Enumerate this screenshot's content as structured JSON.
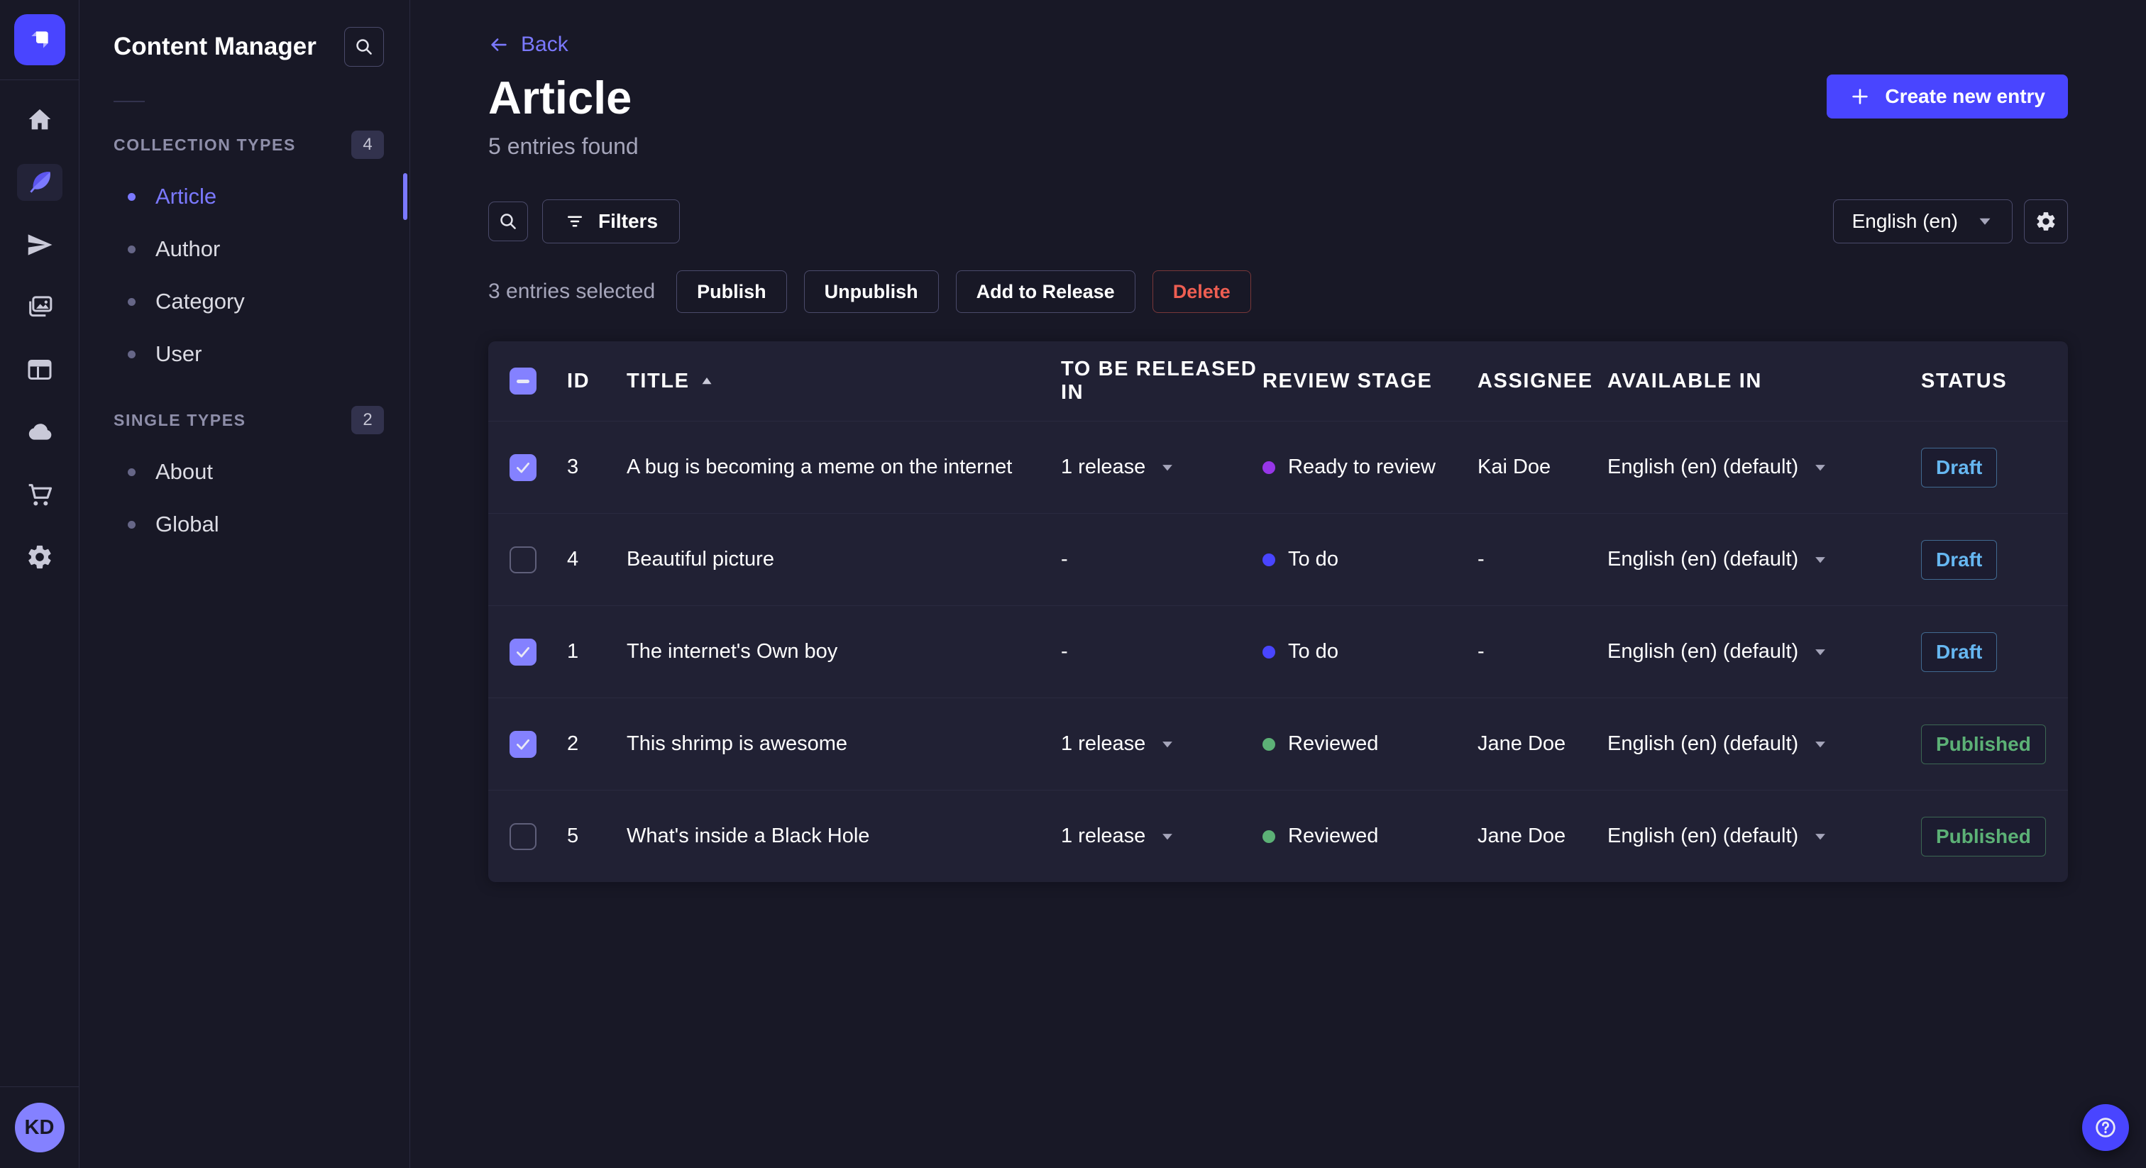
{
  "colors": {
    "pageBg": "#181826",
    "panelBg": "#212134",
    "border": "#2a2a3f",
    "controlBorder": "#4a4a6a",
    "accent": "#4945ff",
    "accentLight": "#7b79ff",
    "textSecondary": "#a5a5ba",
    "danger": "#ee5e52",
    "success": "#5cb176",
    "draftBlue": "#66b7f1"
  },
  "rail": {
    "items": [
      {
        "name": "home",
        "icon": "home",
        "active": false
      },
      {
        "name": "content-manager",
        "icon": "feather",
        "active": true
      },
      {
        "name": "releases",
        "icon": "paper-plane",
        "active": false
      },
      {
        "name": "media-library",
        "icon": "images",
        "active": false
      },
      {
        "name": "content-type-builder",
        "icon": "layout",
        "active": false
      },
      {
        "name": "deploy",
        "icon": "cloud",
        "active": false
      },
      {
        "name": "marketplace",
        "icon": "cart",
        "active": false
      },
      {
        "name": "settings",
        "icon": "gear",
        "active": false
      }
    ],
    "avatar_initials": "KD"
  },
  "sidebar": {
    "title": "Content Manager",
    "collection_types": {
      "label": "COLLECTION TYPES",
      "count": "4",
      "items": [
        {
          "label": "Article",
          "active": true
        },
        {
          "label": "Author",
          "active": false
        },
        {
          "label": "Category",
          "active": false
        },
        {
          "label": "User",
          "active": false
        }
      ]
    },
    "single_types": {
      "label": "SINGLE TYPES",
      "count": "2",
      "items": [
        {
          "label": "About",
          "active": false
        },
        {
          "label": "Global",
          "active": false
        }
      ]
    }
  },
  "header": {
    "back_label": "Back",
    "title": "Article",
    "subtitle": "5 entries found",
    "create_button": "Create new entry"
  },
  "toolbar": {
    "filters_label": "Filters",
    "locale_value": "English (en)"
  },
  "selection": {
    "text": "3 entries selected",
    "actions": [
      {
        "label": "Publish",
        "kind": "default"
      },
      {
        "label": "Unpublish",
        "kind": "default"
      },
      {
        "label": "Add to Release",
        "kind": "default"
      },
      {
        "label": "Delete",
        "kind": "danger"
      }
    ]
  },
  "table": {
    "columns": [
      {
        "label": "ID",
        "sorted": false
      },
      {
        "label": "TITLE",
        "sorted": true
      },
      {
        "label": "TO BE RELEASED IN",
        "sorted": false
      },
      {
        "label": "REVIEW STAGE",
        "sorted": false
      },
      {
        "label": "ASSIGNEE",
        "sorted": false
      },
      {
        "label": "AVAILABLE IN",
        "sorted": false
      },
      {
        "label": "STATUS",
        "sorted": false
      }
    ],
    "header_checkbox": "indeterminate",
    "rows": [
      {
        "checked": true,
        "id": "3",
        "title": "A bug is becoming a meme on the internet",
        "release": "1 release",
        "release_caret": true,
        "stage": {
          "label": "Ready to review",
          "color": "#9736e8"
        },
        "assignee": "Kai Doe",
        "locale": "English (en) (default)",
        "status": {
          "label": "Draft",
          "kind": "draft"
        }
      },
      {
        "checked": false,
        "id": "4",
        "title": "Beautiful picture",
        "release": "-",
        "release_caret": false,
        "stage": {
          "label": "To do",
          "color": "#4945ff"
        },
        "assignee": "-",
        "locale": "English (en) (default)",
        "status": {
          "label": "Draft",
          "kind": "draft"
        }
      },
      {
        "checked": true,
        "id": "1",
        "title": "The internet's Own boy",
        "release": "-",
        "release_caret": false,
        "stage": {
          "label": "To do",
          "color": "#4945ff"
        },
        "assignee": "-",
        "locale": "English (en) (default)",
        "status": {
          "label": "Draft",
          "kind": "draft"
        }
      },
      {
        "checked": true,
        "id": "2",
        "title": "This shrimp is awesome",
        "release": "1 release",
        "release_caret": true,
        "stage": {
          "label": "Reviewed",
          "color": "#5cb176"
        },
        "assignee": "Jane Doe",
        "locale": "English (en) (default)",
        "status": {
          "label": "Published",
          "kind": "published"
        }
      },
      {
        "checked": false,
        "id": "5",
        "title": "What's inside a Black Hole",
        "release": "1 release",
        "release_caret": true,
        "stage": {
          "label": "Reviewed",
          "color": "#5cb176"
        },
        "assignee": "Jane Doe",
        "locale": "English (en) (default)",
        "status": {
          "label": "Published",
          "kind": "published"
        }
      }
    ]
  }
}
